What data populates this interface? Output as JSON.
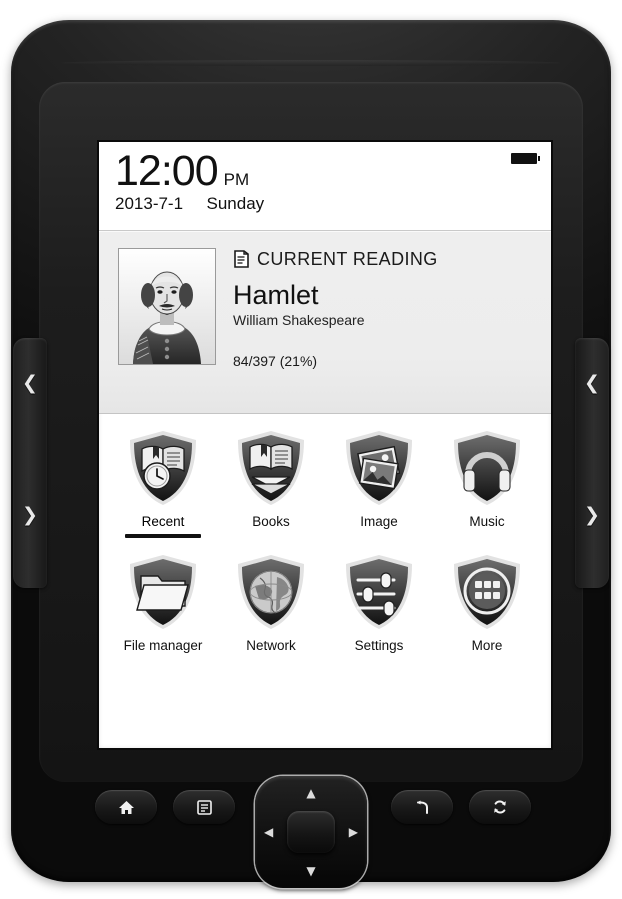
{
  "device": {
    "side_buttons": {
      "prev_page_icon": "chevron-left-icon",
      "next_page_icon": "chevron-right-icon",
      "prev_glyph": "❮",
      "next_glyph": "❯"
    },
    "hardware_buttons": [
      {
        "name": "home",
        "icon": "home-icon"
      },
      {
        "name": "menu",
        "icon": "menu-icon"
      },
      {
        "name": "back",
        "icon": "back-arrow-icon"
      },
      {
        "name": "refresh",
        "icon": "refresh-icon"
      }
    ],
    "dpad": {
      "up_glyph": "▲",
      "down_glyph": "▼",
      "left_glyph": "◀",
      "right_glyph": "▶",
      "center_name": "ok-button"
    }
  },
  "statusbar": {
    "time": "12:00",
    "ampm": "PM",
    "date": "2013-7-1",
    "weekday": "Sunday",
    "battery_icon": "battery-icon"
  },
  "current_reading": {
    "section_label": "CURRENT READING",
    "section_icon": "book-icon",
    "cover_icon": "shakespeare-portrait",
    "title": "Hamlet",
    "author": "William Shakespeare",
    "progress": "84/397 (21%)",
    "current_page": 84,
    "total_pages": 397,
    "percent": 21
  },
  "grid": {
    "selected_index": 0,
    "tiles": [
      {
        "label": "Recent",
        "icon": "recent-icon",
        "selected": true
      },
      {
        "label": "Books",
        "icon": "books-icon",
        "selected": false
      },
      {
        "label": "Image",
        "icon": "image-icon",
        "selected": false
      },
      {
        "label": "Music",
        "icon": "music-icon",
        "selected": false
      },
      {
        "label": "File manager",
        "icon": "file-manager-icon",
        "selected": false
      },
      {
        "label": "Network",
        "icon": "network-icon",
        "selected": false
      },
      {
        "label": "Settings",
        "icon": "settings-icon",
        "selected": false
      },
      {
        "label": "More",
        "icon": "more-icon",
        "selected": false
      }
    ]
  },
  "colors": {
    "screen_bg": "#ffffff",
    "card_bg": "#ededed",
    "text": "#111111",
    "shell": "#141414",
    "shield_dark": "#3a3a3a",
    "shield_rim": "#d8d8d8"
  }
}
